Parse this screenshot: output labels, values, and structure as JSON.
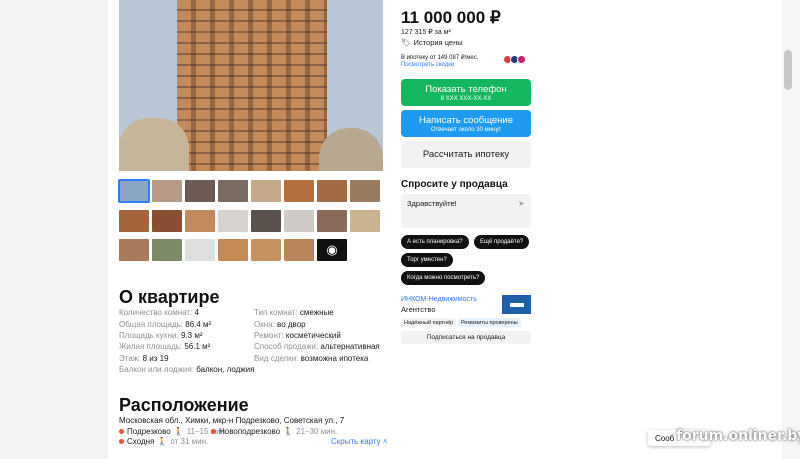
{
  "listing": {
    "price": "11 000 000 ₽",
    "price_per_m2": "127 315 ₽ за м²",
    "price_history_label": "История цены",
    "mortgage_text": "В ипотеку от 149 087 ₽/мес.",
    "mortgage_link": "Посмотреть скидки"
  },
  "actions": {
    "show_phone": "Показать телефон",
    "phone_masked": "8 XXX XXX-XX-XX",
    "write_message": "Написать сообщение",
    "reply_time": "Отвечает около 30 минут",
    "calc_mortgage": "Рассчитать ипотеку"
  },
  "ask": {
    "title": "Спросите у продавца",
    "input_value": "Здравствуйте!",
    "chips": [
      "А есть планировка?",
      "Ещё продаёте?",
      "Торг уместен?",
      "Когда можно посмотреть?"
    ]
  },
  "agency": {
    "name": "ИНКОМ-Недвижимость",
    "type": "Агентство",
    "badges": [
      "Надёжный партнёр",
      "Реквизиты проверены"
    ],
    "subscribe_label": "Подписаться на продавца"
  },
  "about": {
    "title": "О квартире",
    "props_left": [
      {
        "k": "Количество комнат:",
        "v": "4"
      },
      {
        "k": "Общая площадь:",
        "v": "86.4 м²"
      },
      {
        "k": "Площадь кухни:",
        "v": "9.3 м²"
      },
      {
        "k": "Жилая площадь:",
        "v": "56.1 м²"
      },
      {
        "k": "Этаж:",
        "v": "8 из 19"
      },
      {
        "k": "Балкон или лоджия:",
        "v": "балкон, лоджия"
      }
    ],
    "props_right": [
      {
        "k": "Тип комнат:",
        "v": "смежные"
      },
      {
        "k": "Окна:",
        "v": "во двор"
      },
      {
        "k": "Ремонт:",
        "v": "косметический"
      },
      {
        "k": "Способ продажи:",
        "v": "альтернативная"
      },
      {
        "k": "Вид сделки:",
        "v": "возможна ипотека"
      }
    ]
  },
  "location": {
    "title": "Расположение",
    "address": "Московская обл., Химки, мкр-н Подрезково, Советская ул., 7",
    "stations": [
      {
        "name": "Подрезково",
        "time": "11–15 мин."
      },
      {
        "name": "Новоподрезково",
        "time": "21–30 мин."
      },
      {
        "name": "Сходня",
        "time": "от 31 мин."
      }
    ],
    "hide_map": "Скрыть карту"
  },
  "chat": {
    "label": "Сооб"
  },
  "watermark": "forum.onliner.by",
  "colors": {
    "accent": "#2f7df6",
    "green": "#12b760",
    "blue": "#1e9bf0",
    "station_dot": "#e8553a"
  },
  "icons": {
    "price_history": "tag-icon",
    "send": "send-icon",
    "walk": "walk-icon",
    "more_photos": "camera-icon"
  }
}
